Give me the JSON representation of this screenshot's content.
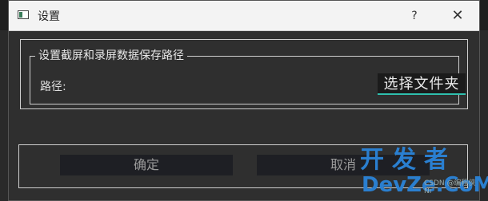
{
  "window": {
    "title": "设置",
    "help_label": "?",
    "close_label": "✕"
  },
  "save_path_group": {
    "legend": "设置截屏和录屏数据保存路径",
    "path_label": "路径:",
    "choose_button_label": "选择文件夹"
  },
  "actions": {
    "ok_label": "确定",
    "cancel_label": "取消"
  },
  "watermark": {
    "line1": "开发者",
    "line2": "DevZe.CoM",
    "small": "CSDN @编程侠Ni"
  },
  "icons": {
    "app": "window-icon",
    "help": "help-icon",
    "close": "close-icon"
  },
  "colors": {
    "accent": "#2fbfae",
    "watermark": "#2a7fd0"
  }
}
